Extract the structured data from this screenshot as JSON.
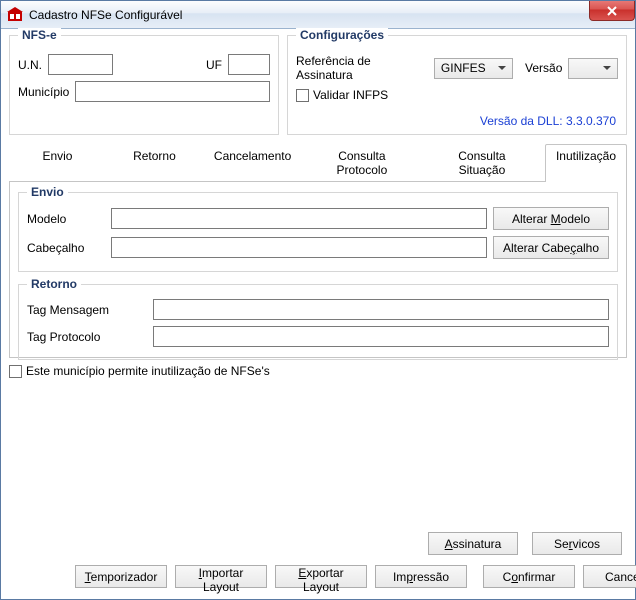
{
  "titlebar": {
    "title": "Cadastro NFSe Configurável"
  },
  "nfse": {
    "legend": "NFS-e",
    "un_label": "U.N.",
    "un_value": "",
    "uf_label": "UF",
    "uf_value": "",
    "municipio_label": "Município",
    "municipio_value": ""
  },
  "config": {
    "legend": "Configurações",
    "ref_label": "Referência de Assinatura",
    "ref_value": "GINFES",
    "versao_label": "Versão",
    "versao_value": "",
    "validar_label": "Validar INFPS",
    "dll_label": "Versão da DLL: 3.3.0.370"
  },
  "tabs": {
    "envio": "Envio",
    "retorno": "Retorno",
    "cancelamento": "Cancelamento",
    "consulta_protocolo": "Consulta Protocolo",
    "consulta_situacao": "Consulta Situação",
    "inutilizacao": "Inutilização"
  },
  "tab_inutil": {
    "envio_legend": "Envio",
    "modelo_label": "Modelo",
    "modelo_value": "",
    "cabecalho_label": "Cabeçalho",
    "cabecalho_value": "",
    "alterar_modelo_pre": "Alterar ",
    "alterar_modelo_u": "M",
    "alterar_modelo_post": "odelo",
    "alterar_cab_pre": "Alterar Cabe",
    "alterar_cab_u": "ç",
    "alterar_cab_post": "alho",
    "retorno_legend": "Retorno",
    "tag_msg_label": "Tag Mensagem",
    "tag_msg_value": "",
    "tag_proto_label": "Tag Protocolo",
    "tag_proto_value": "",
    "permit_label": "Este município permite inutilização de NFSe's"
  },
  "buttons": {
    "assinatura_u": "A",
    "assinatura_post": "ssinatura",
    "servicos_pre": "Se",
    "servicos_u": "r",
    "servicos_post": "vicos",
    "temporizador_u": "T",
    "temporizador_post": "emporizador",
    "importar_u": "I",
    "importar_post": "mportar Layout",
    "exportar_u": "E",
    "exportar_post": "xportar Layout",
    "impressao_pre": "Im",
    "impressao_u": "p",
    "impressao_post": "ressão",
    "confirmar_pre": "C",
    "confirmar_u": "o",
    "confirmar_post": "nfirmar",
    "cancelar_pre": "Cancela",
    "cancelar_u": "r"
  }
}
